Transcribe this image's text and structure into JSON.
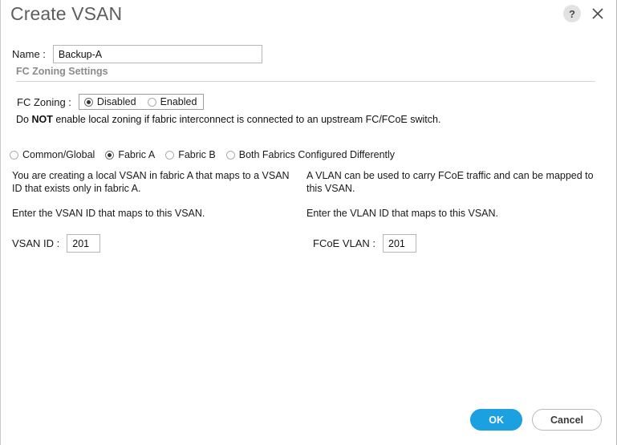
{
  "dialog": {
    "title": "Create VSAN",
    "help_icon": "question-mark-icon",
    "close_icon": "close-x-icon"
  },
  "name_field": {
    "label": "Name :",
    "value": "Backup-A",
    "placeholder": ""
  },
  "section": {
    "heading": "FC Zoning Settings"
  },
  "fc_zoning": {
    "label": "FC Zoning :",
    "options": [
      {
        "label": "Disabled",
        "selected": true
      },
      {
        "label": "Enabled",
        "selected": false
      }
    ],
    "warning_prefix": "Do ",
    "warning_bold": "NOT",
    "warning_suffix": " enable local zoning if fabric interconnect is connected to an upstream FC/FCoE switch."
  },
  "fabric_scope": {
    "options": [
      {
        "label": "Common/Global",
        "selected": false
      },
      {
        "label": "Fabric A",
        "selected": true
      },
      {
        "label": "Fabric B",
        "selected": false
      },
      {
        "label": "Both Fabrics Configured Differently",
        "selected": false
      }
    ]
  },
  "left_column": {
    "description": "You are creating a local VSAN in fabric A that maps to a VSAN ID that exists only in fabric A.",
    "instruction": "Enter the VSAN ID that maps to this VSAN.",
    "field_label": "VSAN ID :",
    "field_value": "201"
  },
  "right_column": {
    "description": "A VLAN can be used to carry FCoE traffic and can be mapped to this VSAN.",
    "instruction": "Enter the VLAN ID that maps to this VSAN.",
    "field_label": "FCoE VLAN :",
    "field_value": "201"
  },
  "footer": {
    "ok_label": "OK",
    "cancel_label": "Cancel"
  },
  "colors": {
    "primary": "#1ba0e1",
    "title_text": "#5e5e60",
    "section_heading": "#8b8b8e",
    "border": "#b6b6b6"
  }
}
